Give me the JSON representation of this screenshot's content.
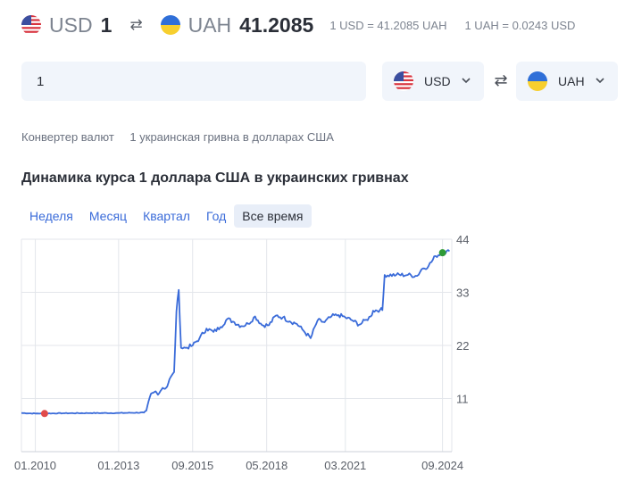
{
  "header": {
    "from_code": "USD",
    "from_amount": "1",
    "swap_icon": "swap-icon",
    "to_code": "UAH",
    "to_amount": "41.2085",
    "rate_forward": "1 USD = 41.2085 UAH",
    "rate_reverse": "1 UAH = 0.0243 USD"
  },
  "converter": {
    "amount_value": "1",
    "from_currency": "USD",
    "to_currency": "UAH"
  },
  "breadcrumbs": [
    "Конвертер валют",
    "1 украинская гривна в долларах США"
  ],
  "chart_section": {
    "title": "Динамика курса 1 доллара США в украинских гривнах",
    "tabs": [
      "Неделя",
      "Месяц",
      "Квартал",
      "Год",
      "Все время"
    ],
    "active_tab": "Все время"
  },
  "colors": {
    "line": "#3a6bd9",
    "min_marker": "#e04b4b",
    "max_marker": "#2e9a36",
    "tab_active_bg": "#e8eef8"
  },
  "chart_data": {
    "type": "line",
    "title": "",
    "xlabel": "",
    "ylabel": "",
    "xticks": [
      "01.2010",
      "01.2013",
      "09.2015",
      "05.2018",
      "03.2021",
      "09.2024"
    ],
    "yticks": [
      11,
      22,
      33,
      44
    ],
    "ylim": [
      0,
      44
    ],
    "xlim": [
      "2009-07",
      "2025-01"
    ],
    "y_axis_side": "right",
    "grid": true,
    "series": [
      {
        "x": [
          "2009-07",
          "2010-01",
          "2011-01",
          "2012-01",
          "2013-01",
          "2013-12",
          "2014-01",
          "2014-02",
          "2014-03",
          "2014-04",
          "2014-05",
          "2014-06",
          "2014-07",
          "2014-08",
          "2014-09",
          "2014-10",
          "2014-11",
          "2014-12",
          "2015-01",
          "2015-02",
          "2015-03",
          "2015-04",
          "2015-06",
          "2015-09",
          "2015-12",
          "2016-03",
          "2016-06",
          "2016-09",
          "2016-12",
          "2017-03",
          "2017-06",
          "2017-09",
          "2017-12",
          "2018-03",
          "2018-06",
          "2018-09",
          "2018-12",
          "2019-03",
          "2019-06",
          "2019-09",
          "2019-12",
          "2020-03",
          "2020-06",
          "2020-09",
          "2020-12",
          "2021-03",
          "2021-06",
          "2021-09",
          "2021-12",
          "2022-02",
          "2022-03",
          "2022-06",
          "2022-07",
          "2022-08",
          "2023-01",
          "2023-06",
          "2023-10",
          "2023-12",
          "2024-03",
          "2024-06",
          "2024-09",
          "2024-12"
        ],
        "y": [
          8.0,
          7.9,
          7.95,
          7.99,
          8.0,
          8.1,
          8.5,
          10.5,
          12,
          12.2,
          12.5,
          11.8,
          12.5,
          13.2,
          13.0,
          13.5,
          15,
          15.8,
          16.5,
          29,
          33.5,
          21.5,
          21.5,
          22.0,
          23.5,
          25.5,
          24.8,
          25.8,
          27.5,
          26.8,
          26.0,
          26.5,
          28.0,
          26.2,
          26.2,
          28.2,
          27.8,
          27.0,
          26.5,
          25.0,
          23.5,
          27.2,
          26.8,
          28.0,
          28.3,
          27.8,
          27.2,
          26.3,
          27.3,
          28.0,
          29.2,
          29.4,
          29.3,
          36.6,
          36.6,
          36.6,
          36.4,
          37.8,
          38.5,
          40.5,
          41.2,
          41.5
        ]
      }
    ],
    "markers": [
      {
        "label": "min",
        "x": "2010-05",
        "y": 7.9,
        "color": "#e04b4b"
      },
      {
        "label": "max",
        "x": "2024-09",
        "y": 41.2,
        "color": "#2e9a36"
      }
    ]
  }
}
